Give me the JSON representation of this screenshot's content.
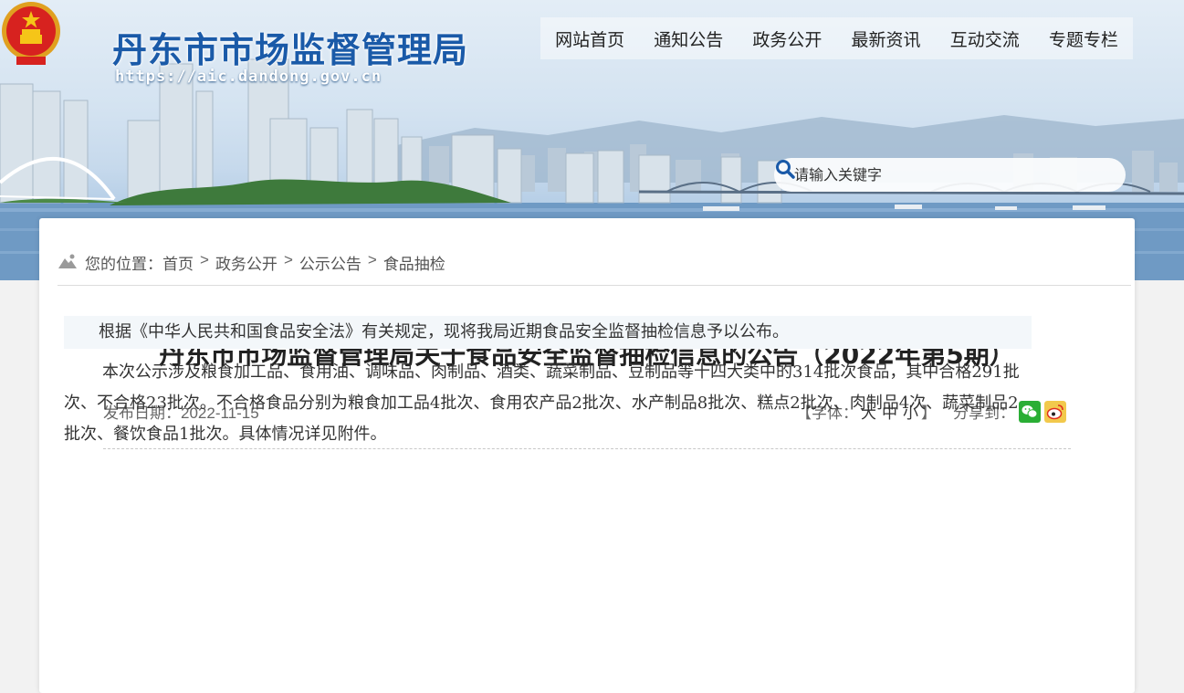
{
  "header": {
    "site_title": "丹东市市场监督管理局",
    "site_url": "https://aic.dandong.gov.cn",
    "nav": [
      "网站首页",
      "通知公告",
      "政务公开",
      "最新资讯",
      "互动交流",
      "专题专栏"
    ],
    "search_placeholder": "请输入关键字"
  },
  "breadcrumb": {
    "prefix": "您的位置：",
    "items": [
      "首页",
      "政务公开",
      "公示公告",
      "食品抽检"
    ],
    "separator": ">"
  },
  "article": {
    "title": "丹东市市场监督管理局关于食品安全监督抽检信息的公告（2022年第5期）",
    "date_label": "发布日期：",
    "date": "2022-11-15",
    "font_label_open": "【字体：",
    "font_sizes": [
      "大",
      "中",
      "小"
    ],
    "font_label_close": "】",
    "share_label": "分享到：",
    "share_icons": [
      "wechat-icon",
      "weibo-icon"
    ],
    "paragraphs": [
      "根据《中华人民共和国食品安全法》有关规定，现将我局近期食品安全监督抽检信息予以公布。",
      "本次公示涉及粮食加工品、食用油、调味品、肉制品、酒类、蔬菜制品、豆制品等十四大类中的314批次食品，其中合格291批次、不合格23批次。不合格食品分别为粮食加工品4批次、食用农产品2批次、水产制品8批次、糕点2批次、肉制品4次、蔬菜制品2批次、餐饮食品1批次。具体情况详见附件。"
    ]
  },
  "colors": {
    "title_blue": "#1a5aa8",
    "wechat_green": "#2aae35",
    "weibo_yellow": "#f2c94c"
  }
}
